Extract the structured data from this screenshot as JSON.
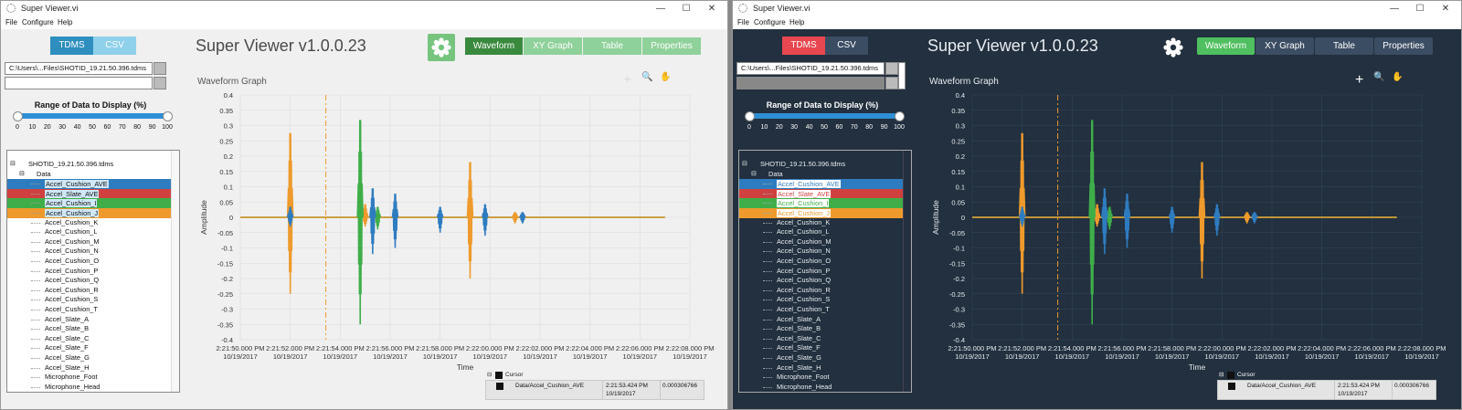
{
  "window": {
    "title": "Super Viewer.vi",
    "controls": [
      "—",
      "☐",
      "✕"
    ]
  },
  "menu": [
    "File",
    "Configure",
    "Help"
  ],
  "format_toggle": [
    "TDMS",
    "CSV"
  ],
  "app_title": "Super Viewer v1.0.0.23",
  "tabs": [
    "Waveform",
    "XY Graph",
    "Table",
    "Properties"
  ],
  "file_path": "C:\\Users\\...Files\\SHOTID_19.21.50.396.tdms",
  "range_label": "Range of Data to Display (%)",
  "range_ticks": [
    "0",
    "10",
    "20",
    "30",
    "40",
    "50",
    "60",
    "70",
    "80",
    "90",
    "100"
  ],
  "range_value": [
    0,
    100
  ],
  "tree": {
    "file": "SHOTID_19.21.50.396.tdms",
    "group": "Data",
    "channels": [
      "Accel_Cushion_AVE",
      "Accel_Slate_AVE",
      "Accel_Cushion_I",
      "Accel_Cushion_J",
      "Accel_Cushion_K",
      "Accel_Cushion_L",
      "Accel_Cushion_M",
      "Accel_Cushion_N",
      "Accel_Cushion_O",
      "Accel_Cushion_P",
      "Accel_Cushion_Q",
      "Accel_Cushion_R",
      "Accel_Cushion_S",
      "Accel_Cushion_T",
      "Accel_Slate_A",
      "Accel_Slate_B",
      "Accel_Slate_C",
      "Accel_Slate_F",
      "Accel_Slate_G",
      "Accel_Slate_H",
      "Microphone_Foot",
      "Microphone_Head"
    ],
    "highlight_colors": [
      "#2e7cc0",
      "#d0403f",
      "#3fae49",
      "#ee9a2c"
    ]
  },
  "graph": {
    "title": "Waveform Graph",
    "y_label": "Amplitude",
    "x_label": "Time",
    "y_ticks": [
      "0.4",
      "0.35",
      "0.3",
      "0.25",
      "0.2",
      "0.15",
      "0.1",
      "0.05",
      "0",
      "-0.05",
      "-0.1",
      "-0.15",
      "-0.2",
      "-0.25",
      "-0.3",
      "-0.35",
      "-0.4"
    ],
    "x_ticks": [
      {
        "time": "2:21:50.000 PM",
        "date": "10/19/2017"
      },
      {
        "time": "2:21:52.000 PM",
        "date": "10/19/2017"
      },
      {
        "time": "2:21:54.000 PM",
        "date": "10/19/2017"
      },
      {
        "time": "2:21:56.000 PM",
        "date": "10/19/2017"
      },
      {
        "time": "2:21:58.000 PM",
        "date": "10/19/2017"
      },
      {
        "time": "2:22:00.000 PM",
        "date": "10/19/2017"
      },
      {
        "time": "2:22:02.000 PM",
        "date": "10/19/2017"
      },
      {
        "time": "2:22:04.000 PM",
        "date": "10/19/2017"
      },
      {
        "time": "2:22:06.000 PM",
        "date": "10/19/2017"
      },
      {
        "time": "2:22:08.000 PM",
        "date": "10/19/2017"
      }
    ],
    "series_colors": [
      "#ee9a2c",
      "#3fae49",
      "#2e7cc0"
    ],
    "cursor_color": "#ee9a2c"
  },
  "chart_data": {
    "type": "line",
    "xlabel": "Time",
    "ylabel": "Amplitude",
    "ylim": [
      -0.4,
      0.4
    ],
    "xlim": [
      "2:21:50.000 PM",
      "2:22:08.000 PM"
    ],
    "series": [
      {
        "name": "Accel_Cushion_J",
        "color": "#ee9a2c",
        "spikes": [
          {
            "t": "2:21:52.000 PM",
            "min": -0.25,
            "max": 0.32
          },
          {
            "t": "2:21:55.000 PM",
            "min": -0.03,
            "max": 0.05
          },
          {
            "t": "2:21:59.200 PM",
            "min": -0.2,
            "max": 0.21
          },
          {
            "t": "2:22:01.000 PM",
            "min": -0.02,
            "max": 0.02
          }
        ]
      },
      {
        "name": "Accel_Cushion_I",
        "color": "#3fae49",
        "spikes": [
          {
            "t": "2:21:54.800 PM",
            "min": -0.35,
            "max": 0.37
          },
          {
            "t": "2:21:55.500 PM",
            "min": -0.04,
            "max": 0.04
          }
        ]
      },
      {
        "name": "Accel_Cushion_AVE",
        "color": "#2e7cc0",
        "spikes": [
          {
            "t": "2:21:52.000 PM",
            "min": -0.03,
            "max": 0.04
          },
          {
            "t": "2:21:55.300 PM",
            "min": -0.12,
            "max": 0.11
          },
          {
            "t": "2:21:56.200 PM",
            "min": -0.1,
            "max": 0.09
          },
          {
            "t": "2:21:58.000 PM",
            "min": -0.05,
            "max": 0.04
          },
          {
            "t": "2:21:59.800 PM",
            "min": -0.06,
            "max": 0.05
          },
          {
            "t": "2:22:01.300 PM",
            "min": -0.02,
            "max": 0.02
          }
        ]
      }
    ],
    "cursor": {
      "time": "2:21:53.424 PM",
      "date": "10/19/2017"
    }
  },
  "cursor_table": {
    "header": "Cursor",
    "row": {
      "channel": "Data/Accel_Cushion_AVE",
      "time": "2:21:53.424 PM",
      "date": "10/19/2017",
      "value": "0.000306766"
    }
  },
  "themes": {
    "light": {
      "panel_bg": "#f0f0f0",
      "grid": "#dcdcdc",
      "axis_text": "#333333",
      "tdms_bg": "#2e8fbf",
      "csv_bg": "#8fd0ea",
      "tab_active": "#3a8a3e",
      "tab_inactive": "#8fd19a",
      "gear_bg": "#76c47e"
    },
    "dark": {
      "panel_bg": "#22303f",
      "grid": "#33465a",
      "axis_text": "#e8ecf0",
      "tdms_bg": "#e8474f",
      "csv_bg": "#3b4d63",
      "tab_active": "#4fbf5f",
      "tab_inactive": "#3b4d63",
      "gear_bg": "#22303f"
    }
  }
}
